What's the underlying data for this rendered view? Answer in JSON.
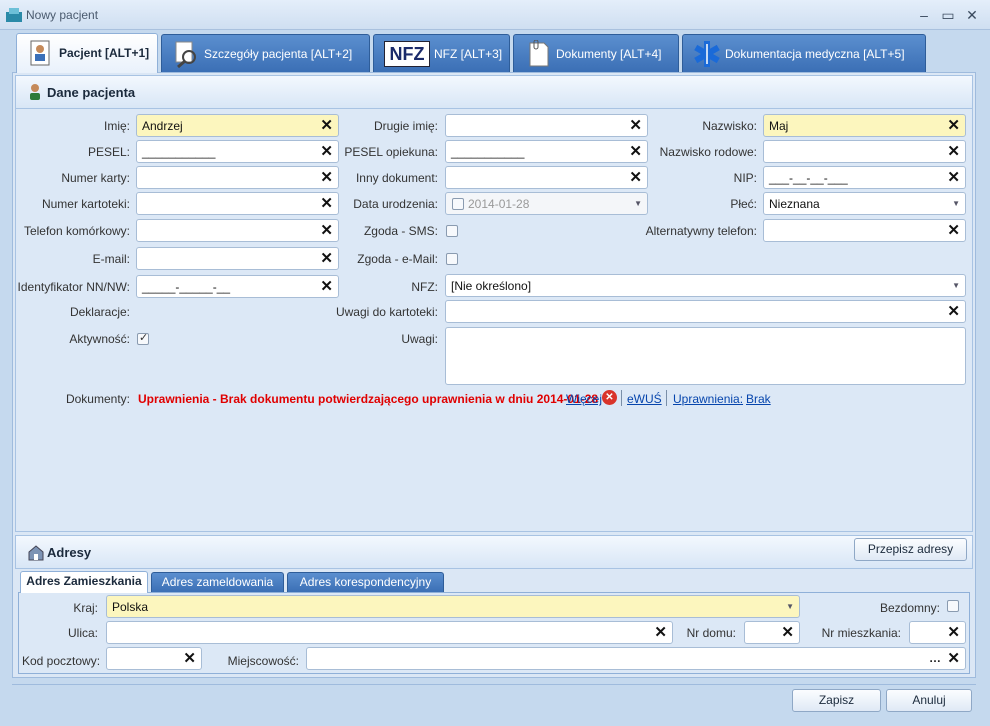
{
  "window": {
    "title": "Nowy pacjent",
    "minimize": "–",
    "maximize": "▭",
    "close": "✕"
  },
  "tabs": [
    {
      "label": "Pacjent [ALT+1]",
      "icon": "patient-card-icon",
      "active": true
    },
    {
      "label": "Szczegóły pacjenta [ALT+2]",
      "icon": "magnifier-icon",
      "active": false
    },
    {
      "label": "NFZ [ALT+3]",
      "icon": "nfz-logo-icon",
      "icon_text": "NFZ",
      "active": false
    },
    {
      "label": "Dokumenty [ALT+4]",
      "icon": "document-clip-icon",
      "active": false
    },
    {
      "label": "Dokumentacja medyczna [ALT+5]",
      "icon": "medical-star-icon",
      "active": false
    }
  ],
  "patient": {
    "title": "Dane pacjenta",
    "fields": {
      "imie": {
        "label": "Imię:",
        "value": "Andrzej"
      },
      "drugie_imie": {
        "label": "Drugie imię:",
        "value": ""
      },
      "nazwisko": {
        "label": "Nazwisko:",
        "value": "Maj"
      },
      "pesel": {
        "label": "PESEL:",
        "value": "___________"
      },
      "pesel_opiekuna": {
        "label": "PESEL opiekuna:",
        "value": "___________"
      },
      "nazwisko_rodowe": {
        "label": "Nazwisko rodowe:",
        "value": ""
      },
      "numer_karty": {
        "label": "Numer karty:",
        "value": ""
      },
      "inny_dokument": {
        "label": "Inny dokument:",
        "value": ""
      },
      "nip": {
        "label": "NIP:",
        "value": "___-__-__-___"
      },
      "numer_kartoteki": {
        "label": "Numer kartoteki:",
        "value": ""
      },
      "data_urodzenia": {
        "label": "Data urodzenia:",
        "value": "2014-01-28"
      },
      "plec": {
        "label": "Płeć:",
        "value": "Nieznana"
      },
      "telefon": {
        "label": "Telefon komórkowy:",
        "value": ""
      },
      "zgoda_sms": {
        "label": "Zgoda - SMS:"
      },
      "alt_telefon": {
        "label": "Alternatywny telefon:",
        "value": ""
      },
      "email": {
        "label": "E-mail:",
        "value": ""
      },
      "zgoda_email": {
        "label": "Zgoda - e-Mail:"
      },
      "identyfikator": {
        "label": "Identyfikator NN/NW:",
        "value": "_____-_____-__"
      },
      "nfz": {
        "label": "NFZ:",
        "value": "[Nie określono]"
      },
      "deklaracje": {
        "label": "Deklaracje:"
      },
      "uwagi_kartoteki": {
        "label": "Uwagi do kartoteki:",
        "value": ""
      },
      "aktywnosc": {
        "label": "Aktywność:"
      },
      "uwagi": {
        "label": "Uwagi:",
        "value": ""
      }
    },
    "documents": {
      "label": "Dokumenty:",
      "warning": "Uprawnienia - Brak dokumentu potwierdzającego uprawnienia w dniu 2014-01-28",
      "more_link": "Więcej",
      "ewus_link": "eWUŚ",
      "permissions_link": "Uprawnienia:",
      "none_link": "Brak"
    }
  },
  "address": {
    "title": "Adresy",
    "copy_button": "Przepisz adresy",
    "tabs": [
      {
        "label": "Adres Zamieszkania",
        "active": true
      },
      {
        "label": "Adres zameldowania",
        "active": false
      },
      {
        "label": "Adres korespondencyjny",
        "active": false
      }
    ],
    "fields": {
      "kraj": {
        "label": "Kraj:",
        "value": "Polska"
      },
      "bezdomny": {
        "label": "Bezdomny:"
      },
      "ulica": {
        "label": "Ulica:",
        "value": ""
      },
      "nr_domu": {
        "label": "Nr domu:",
        "value": ""
      },
      "nr_mieszkania": {
        "label": "Nr mieszkania:",
        "value": ""
      },
      "kod_pocztowy": {
        "label": "Kod pocztowy:",
        "value": ""
      },
      "miejscowosc": {
        "label": "Miejscowość:",
        "value": ""
      }
    }
  },
  "footer": {
    "save": "Zapisz",
    "cancel": "Anuluj"
  },
  "colors": {
    "tab_blue": "#3b6fb5",
    "highlight_yellow": "#fcf6be",
    "warning_red": "#e00000",
    "link_blue": "#0645ad"
  }
}
